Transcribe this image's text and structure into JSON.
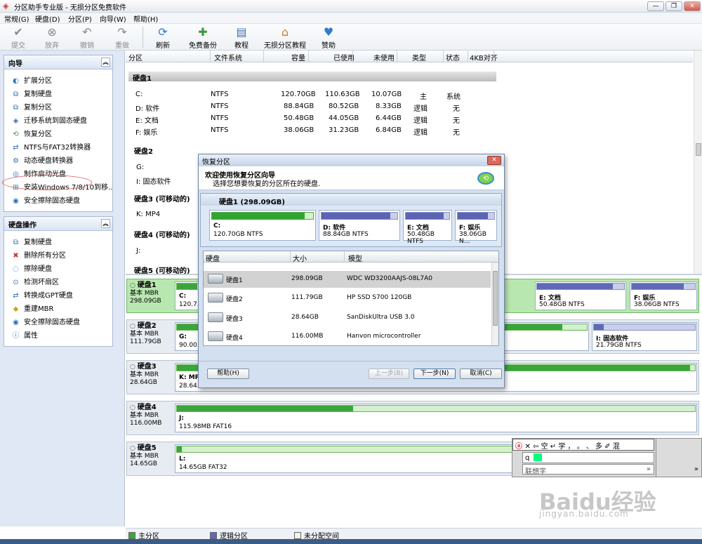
{
  "window": {
    "title": "分区助手专业版 - 无损分区免费软件"
  },
  "menubar": [
    "常规(G)",
    "硬盘(D)",
    "分区(P)",
    "向导(W)",
    "帮助(H)"
  ],
  "toolbar": {
    "commit": "提交",
    "discard": "放弃",
    "undo": "撤销",
    "redo": "重做",
    "refresh": "刷新",
    "free_backup": "免费备份",
    "tutorial": "教程",
    "lossless_tutorial": "无损分区教程",
    "donate": "赞助"
  },
  "wizard_panel": {
    "title": "向导",
    "items": [
      "扩展分区",
      "复制硬盘",
      "复制分区",
      "迁移系统到固态硬盘",
      "恢复分区",
      "NTFS与FAT32转换器",
      "动态硬盘转换器",
      "制作启动光盘",
      "安装Windows 7/8/10到移...",
      "安全擦除固态硬盘"
    ]
  },
  "disk_ops_panel": {
    "title": "硬盘操作",
    "items": [
      "复制硬盘",
      "删除所有分区",
      "擦除硬盘",
      "检测坏扇区",
      "转换成GPT硬盘",
      "重建MBR",
      "安全擦除固态硬盘",
      "属性"
    ]
  },
  "columns": [
    "分区",
    "文件系统",
    "容量",
    "已使用",
    "未使用",
    "类型",
    "状态",
    "4KB对齐"
  ],
  "disk_list": {
    "disk1": {
      "label": "硬盘1",
      "rows": [
        {
          "name": "C:",
          "fs": "NTFS",
          "cap": "120.70GB",
          "used": "110.63GB",
          "free": "10.07GB",
          "type": "主",
          "status": "系统"
        },
        {
          "name": "D: 软件",
          "fs": "NTFS",
          "cap": "88.84GB",
          "used": "80.52GB",
          "free": "8.33GB",
          "type": "逻辑",
          "status": "无"
        },
        {
          "name": "E: 文档",
          "fs": "NTFS",
          "cap": "50.48GB",
          "used": "44.05GB",
          "free": "6.44GB",
          "type": "逻辑",
          "status": "无"
        },
        {
          "name": "F: 娱乐",
          "fs": "NTFS",
          "cap": "38.06GB",
          "used": "31.23GB",
          "free": "6.84GB",
          "type": "逻辑",
          "status": "无"
        }
      ]
    },
    "disk2": {
      "label": "硬盘2",
      "rows": [
        "G:",
        "I: 固态软件"
      ]
    },
    "disk3": {
      "label": "硬盘3 (可移动的)",
      "rows": [
        "K: MP4"
      ]
    },
    "disk4": {
      "label": "硬盘4 (可移动的)",
      "rows": [
        "J:"
      ]
    },
    "disk5": {
      "label": "硬盘5 (可移动的)"
    }
  },
  "disk_map": [
    {
      "name": "硬盘1",
      "type": "基本 MBR",
      "size": "298.09GB",
      "parts": [
        {
          "n": "C:",
          "s": "120.7..."
        },
        {
          "n": "E: 文档",
          "s": "50.48GB NTFS",
          "fill": 0.87
        },
        {
          "n": "F: 娱乐",
          "s": "38.06GB NTFS",
          "fill": 0.82
        }
      ]
    },
    {
      "name": "硬盘2",
      "type": "基本 MBR",
      "size": "111.79GB",
      "parts": [
        {
          "n": "G:",
          "s": "90.00..."
        },
        {
          "n": "I: 固态软件",
          "s": "21.79GB NTFS",
          "fill": 0.1
        }
      ]
    },
    {
      "name": "硬盘3",
      "type": "基本 MBR",
      "size": "28.64GB",
      "parts": [
        {
          "n": "K: MP4",
          "s": "28.64..."
        }
      ]
    },
    {
      "name": "硬盘4",
      "type": "基本 MBR",
      "size": "116.00MB",
      "parts": [
        {
          "n": "J:",
          "s": "115.98MB FAT16",
          "fill": 0.34
        }
      ]
    },
    {
      "name": "硬盘5",
      "type": "基本 MBR",
      "size": "14.65GB",
      "parts": [
        {
          "n": "L:",
          "s": "14.65GB FAT32",
          "fill": 0.01
        }
      ]
    }
  ],
  "legend": [
    "主分区",
    "逻辑分区",
    "未分配空间"
  ],
  "dialog": {
    "title": "恢复分区",
    "heading": "欢迎使用恢复分区向导",
    "subheading": "选择您想要恢复的分区所在的硬盘.",
    "disk_box_title": "硬盘1 (298.09GB)",
    "partitions": [
      {
        "n": "C:",
        "s": "120.70GB NTFS",
        "fill": 0.92
      },
      {
        "n": "D: 软件",
        "s": "88.84GB NTFS",
        "fill": 0.91
      },
      {
        "n": "E: 文档",
        "s": "50.48GB NTFS",
        "fill": 0.87
      },
      {
        "n": "F: 娱乐",
        "s": "38.06GB N...",
        "fill": 0.82
      }
    ],
    "table_headers": [
      "硬盘",
      "大小",
      "模型"
    ],
    "table_rows": [
      {
        "disk": "硬盘1",
        "size": "298.09GB",
        "model": "WDC WD3200AAJS-08L7A0"
      },
      {
        "disk": "硬盘2",
        "size": "111.79GB",
        "model": "HP SSD S700 120GB"
      },
      {
        "disk": "硬盘3",
        "size": "28.64GB",
        "model": "SanDiskUltra USB 3.0"
      },
      {
        "disk": "硬盘4",
        "size": "116.00MB",
        "model": "Hanvon  microcontroller"
      }
    ],
    "selected_row": 0,
    "buttons": {
      "help": "帮助(H)",
      "prev": "上一步(B)",
      "next": "下一步(N)",
      "cancel": "取消(C)"
    }
  },
  "ime": {
    "toolbar": "✕ ⇦ 空 ↵ 学 ， 。 、 多 ✐ 混",
    "input": "q",
    "suggest": "联想字",
    "more": "»"
  },
  "watermark": {
    "brand": "Baidu经验",
    "url": "jingyan.baidu.com"
  },
  "colors": {
    "primary": "#3aa63a",
    "logical": "#6069b8",
    "selected_disk": "#b9e7b0"
  }
}
